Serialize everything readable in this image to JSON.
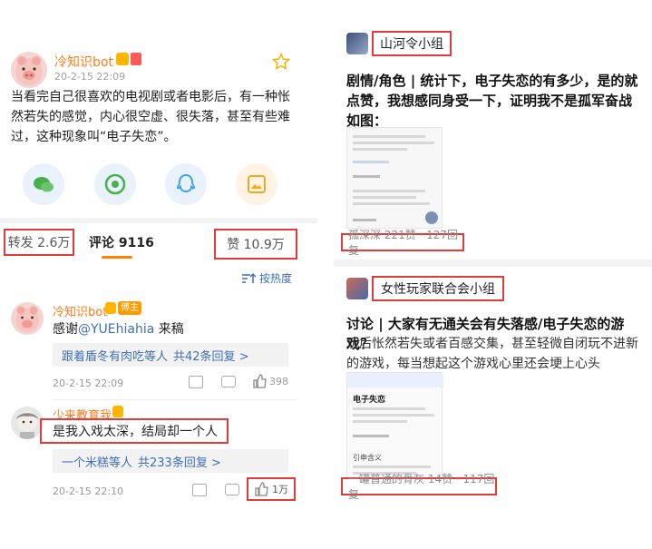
{
  "left": {
    "post": {
      "author": "冷知识bot",
      "time": "20-2-15 22:09",
      "text": "当看完自己很喜欢的电视剧或者电影后，有一种怅然若失的感觉，内心很空虚、很失落，甚至有些难过，这种现象叫“电子失恋”。"
    },
    "share_icons": [
      "wechat-icon",
      "moments-icon",
      "qq-icon",
      "save-image-icon"
    ],
    "stats": {
      "repost": "转发 2.6万",
      "comment": "评论 9116",
      "like": "赞 10.9万"
    },
    "sort_label": "按热度",
    "comments": [
      {
        "author": "冷知识bot",
        "badge": "博主",
        "prefix": "感谢",
        "mention": "@YUEhiahia",
        "suffix": " 来稿",
        "reply_users": "跟着盾冬有肉吃等人",
        "reply_count": "共42条回复 >",
        "time": "20-2-15 22:09",
        "likes": "398"
      },
      {
        "author": "少来教育我",
        "text": "是我入戏太深，结局却一个人",
        "reply_users": "一个米糕等人",
        "reply_count": "共233条回复 >",
        "time": "20-2-15 22:10",
        "likes": "1万"
      }
    ],
    "colors": {
      "accent_orange": "#ff7a19",
      "link_blue": "#3f6fb4",
      "highlight_red": "#e23b3b"
    }
  },
  "right": {
    "posts": [
      {
        "group": "山河令小组",
        "title": "剧情/角色 | 统计下，电子失恋的有多少，是的就点赞，我想感同身受一下，证明我不是孤军奋战 如图：",
        "footer": "孤深深 221赞 · 127回复"
      },
      {
        "group": "女性玩家联合会小组",
        "title": "讨论 | 大家有无通关会有失落感/电子失恋的游戏？",
        "body": "玩后怅然若失或者百感交集，甚至轻微自闭玩不进新的游戏，每当想起这个游戏心里还会埂上心头",
        "thumb_title": "电子失恋",
        "thumb_sub": "引申含义",
        "footer": "一罐普通的骨灰 14赞 · 117回复"
      }
    ]
  }
}
